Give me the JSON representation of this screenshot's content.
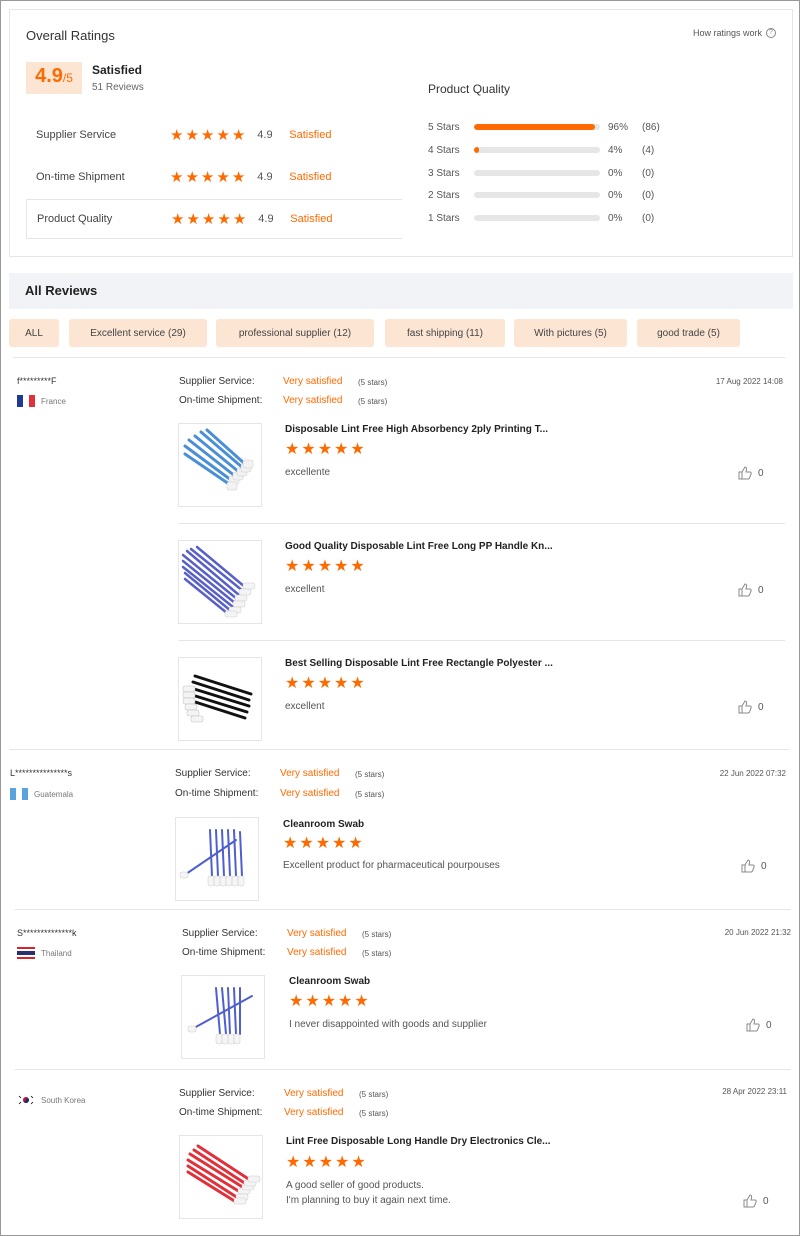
{
  "overall": {
    "title": "Overall Ratings",
    "how_link": "How ratings work",
    "score": "4.9",
    "score_suffix": "/5",
    "label": "Satisfied",
    "reviews_count": "51 Reviews",
    "sub_ratings": [
      {
        "label": "Supplier Service",
        "score": "4.9",
        "status": "Satisfied"
      },
      {
        "label": "On-time Shipment",
        "score": "4.9",
        "status": "Satisfied"
      },
      {
        "label": "Product Quality",
        "score": "4.9",
        "status": "Satisfied"
      }
    ]
  },
  "product_quality": {
    "title": "Product Quality",
    "rows": [
      {
        "label": "5 Stars",
        "fraction": 0.96,
        "pct": "96%",
        "count": "(86)"
      },
      {
        "label": "4 Stars",
        "fraction": 0.04,
        "pct": "4%",
        "count": "(4)"
      },
      {
        "label": "3 Stars",
        "fraction": 0,
        "pct": "0%",
        "count": "(0)"
      },
      {
        "label": "2 Stars",
        "fraction": 0,
        "pct": "0%",
        "count": "(0)"
      },
      {
        "label": "1 Stars",
        "fraction": 0,
        "pct": "0%",
        "count": "(0)"
      }
    ]
  },
  "all_reviews": {
    "title": "All Reviews",
    "filters": [
      "ALL",
      "Excellent service (29)",
      "professional supplier (12)",
      "fast shipping (11)",
      "With pictures (5)",
      "good trade (5)"
    ]
  },
  "labels": {
    "supplier_service": "Supplier Service:",
    "ontime_shipment": "On-time Shipment:"
  },
  "reviews": [
    {
      "user": "f*********F",
      "country": "France",
      "date": "17 Aug 2022 14:08",
      "supplier_service": "Very satisfied",
      "supplier_stars": "(5 stars)",
      "shipment": "Very satisfied",
      "shipment_stars": "(5 stars)",
      "products": [
        {
          "title": "Disposable Lint Free High Absorbency 2ply Printing T...",
          "text": "excellente",
          "likes": "0"
        },
        {
          "title": "Good Quality Disposable Lint Free Long PP Handle Kn...",
          "text": "excellent",
          "likes": "0"
        },
        {
          "title": "Best Selling Disposable Lint Free Rectangle Polyester ...",
          "text": "excellent",
          "likes": "0"
        }
      ]
    },
    {
      "user": "L***************s",
      "country": "Guatemala",
      "date": "22 Jun 2022 07:32",
      "supplier_service": "Very satisfied",
      "supplier_stars": "(5 stars)",
      "shipment": "Very satisfied",
      "shipment_stars": "(5 stars)",
      "products": [
        {
          "title": "Cleanroom Swab",
          "text": "Excellent product for pharmaceutical pourpouses",
          "likes": "0"
        }
      ]
    },
    {
      "user": "S**************k",
      "country": "Thailand",
      "date": "20 Jun 2022 21:32",
      "supplier_service": "Very satisfied",
      "supplier_stars": "(5 stars)",
      "shipment": "Very satisfied",
      "shipment_stars": "(5 stars)",
      "products": [
        {
          "title": "Cleanroom Swab",
          "text": "I never disappointed with goods and supplier",
          "likes": "0"
        }
      ]
    },
    {
      "user": "",
      "country": "South Korea",
      "date": "28 Apr 2022 23:11",
      "supplier_service": "Very satisfied",
      "supplier_stars": "(5 stars)",
      "shipment": "Very satisfied",
      "shipment_stars": "(5 stars)",
      "products": [
        {
          "title": "Lint Free Disposable Long Handle Dry Electronics Cle...",
          "text_line1": "A good seller of good products.",
          "text_line2": "I'm planning to buy it again next time.",
          "likes": "0"
        }
      ]
    }
  ],
  "colors": {
    "accent": "#ff6a00",
    "chip_bg": "#fde5d4",
    "section_bg": "#f2f3f7"
  },
  "icons": {
    "star": "star-icon",
    "like": "thumbs-up-icon",
    "help": "question-circle-icon"
  }
}
